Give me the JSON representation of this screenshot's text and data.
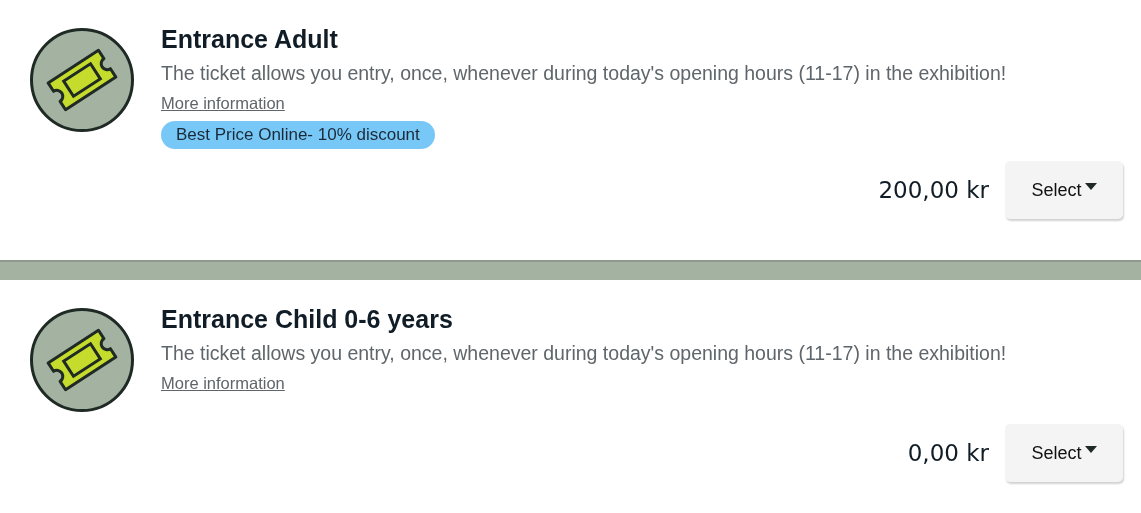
{
  "tickets": [
    {
      "title": "Entrance Adult",
      "description": "The ticket allows you entry, once, whenever during today's opening hours (11-17) in the exhibition!",
      "link": "More information",
      "badge": "Best Price Online- 10% discount",
      "price": "200,00 kr",
      "button": "Select"
    },
    {
      "title": "Entrance Child 0-6 years",
      "description": "The ticket allows you entry, once, whenever during today's opening hours (11-17) in the exhibition!",
      "link": "More information",
      "price": "0,00 kr",
      "button": "Select"
    }
  ]
}
